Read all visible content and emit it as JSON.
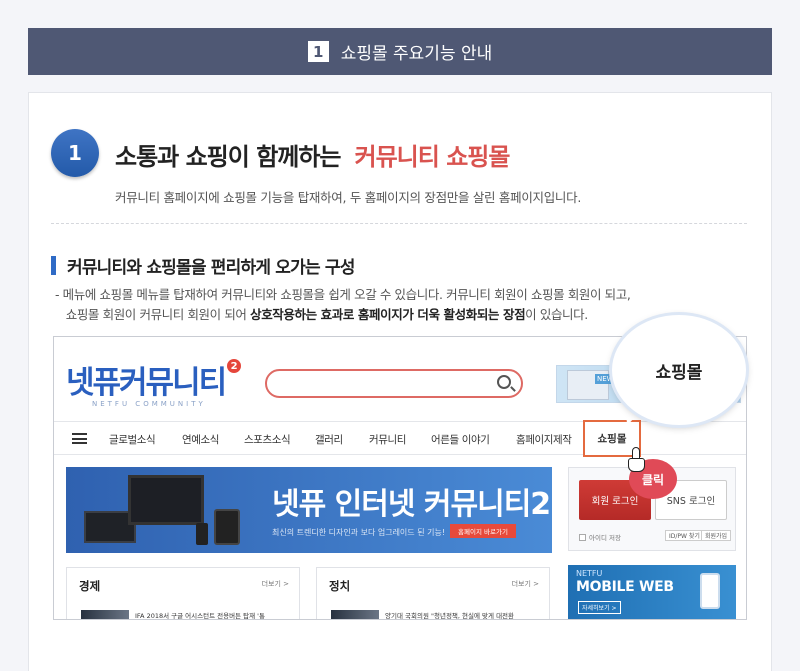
{
  "header": {
    "number": "1",
    "title": "쇼핑몰 주요기능 안내"
  },
  "intro": {
    "number": "1",
    "headline_prefix": "소통과 쇼핑이 함께하는",
    "headline_highlight": "커뮤니티 쇼핑몰",
    "subline": "커뮤니티 홈페이지에 쇼핑몰 기능을 탑재하여, 두 홈페이지의 장점만을 살린 홈페이지입니다."
  },
  "section": {
    "title": "커뮤니티와 쇼핑몰을 편리하게 오가는 구성",
    "desc_line1": "- 메뉴에 쇼핑몰 메뉴를 탑재하여 커뮤니티와 쇼핑몰을 쉽게 오갈 수 있습니다.  커뮤니티 회원이 쇼핑몰 회원이 되고,",
    "desc_line2_a": "쇼핑몰 회원이 커뮤니티 회원이 되어 ",
    "desc_line2_b": "상호작용하는 효과로 홈페이지가 더욱 활성화되는 장점",
    "desc_line2_c": "이 있습니다."
  },
  "preview": {
    "logo": "넷퓨커뮤니티",
    "logo_badge": "2",
    "logo_sub": "NETFU COMMUNITY",
    "banner_top_tag": "NEW",
    "nav_items": [
      "글로벌소식",
      "연예소식",
      "스포츠소식",
      "갤러리",
      "커뮤니티",
      "어른들 이야기",
      "홈페이지제작"
    ],
    "nav_shop": "쇼핑몰",
    "main_banner_title": "넷퓨 인터넷 커뮤니티2",
    "main_banner_sub": "최신의 트렌디한 디자인과 보다 업그레이드 된 기능!",
    "main_banner_btn": "홈페이지 바로가기",
    "login_button": "회원 로그인",
    "sns_login_button": "SNS 로그인",
    "auto_save": "아이디 저장",
    "find_idpw": "ID/PW 찾기",
    "join": "회원가입",
    "news": [
      {
        "title": "경제",
        "more": "더보기 >",
        "text": "IFA 2018서 구글 어시스턴트 전용버튼 탑재 '통"
      },
      {
        "title": "정치",
        "more": "더보기 >",
        "text": "양기대 국회의원 \"청년정책, 현실에 맞게 대전환"
      }
    ],
    "mobile_web": {
      "t1": "NETFU",
      "t2": "MOBILE WEB",
      "t3": "자세히보기 >"
    }
  },
  "callout": {
    "label": "쇼핑몰",
    "click": "클릭"
  }
}
